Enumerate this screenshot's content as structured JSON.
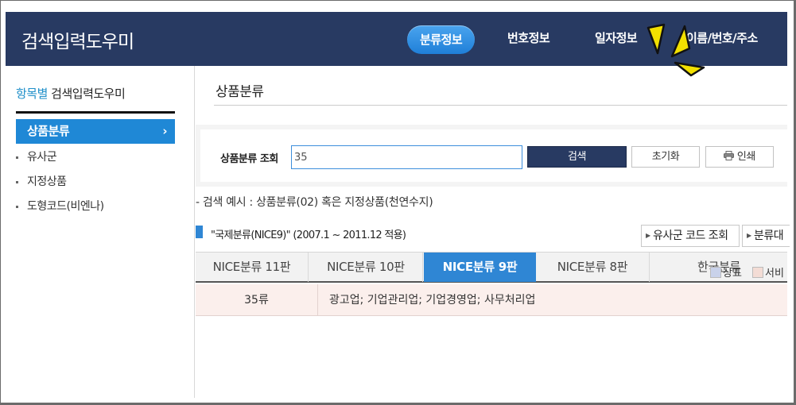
{
  "app": {
    "title": "검색입력도우미"
  },
  "nav": {
    "items": [
      {
        "label": "분류정보",
        "active": true
      },
      {
        "label": "번호정보",
        "active": false
      },
      {
        "label": "일자정보",
        "active": false
      },
      {
        "label": "이름/번호/주소",
        "active": false
      }
    ]
  },
  "sidebar": {
    "heading_accent": "항목별",
    "heading_rest": " 검색입력도우미",
    "active_item": "상품분류",
    "active_chevron": "›",
    "items": [
      "유사군",
      "지정상품",
      "도형코드(비엔나)"
    ]
  },
  "main": {
    "page_title": "상품분류",
    "search": {
      "label": "상품분류 조회",
      "value": "35",
      "search_button": "검색",
      "reset_button": "초기화",
      "print_button": "인쇄",
      "print_icon": "printer-icon"
    },
    "example_text": "- 검색 예시 : 상품분류(02) 혹은 지정상품(천연수지)",
    "section_title": "\"국제분류(NICE9)\" (2007.1 ~ 2011.12 적용)",
    "buttons": {
      "similar_group_code": "유사군 코드 조회",
      "classification_table": "분류대"
    },
    "tabs": [
      {
        "label": "NICE분류 11판",
        "active": false
      },
      {
        "label": "NICE분류 10판",
        "active": false
      },
      {
        "label": "NICE분류 9판",
        "active": true
      },
      {
        "label": "NICE분류 8판",
        "active": false
      },
      {
        "label": "한국분류",
        "active": false
      }
    ],
    "legend": {
      "trademark": "상표",
      "service": "서비",
      "trademark_color": "#c9d2ea",
      "service_color": "#f3dcd5"
    },
    "results": [
      {
        "class": "35류",
        "description": "광고업; 기업관리업; 기업경영업; 사무처리업"
      }
    ]
  },
  "colors": {
    "header_bg": "#283a62",
    "accent_blue": "#2f86d4",
    "marker_yellow": "#f2e000",
    "result_row_bg": "#fbefec"
  }
}
